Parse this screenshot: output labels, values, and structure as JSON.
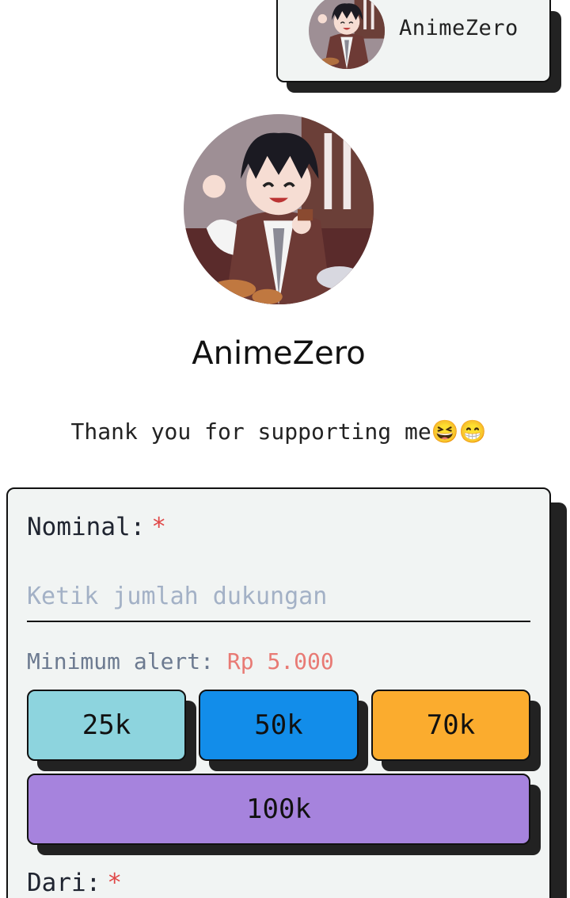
{
  "header": {
    "chip_name": "AnimeZero",
    "avatar_icon": "anime-avatar-image"
  },
  "profile": {
    "name": "AnimeZero",
    "tagline": "Thank you for supporting me😆😁"
  },
  "form": {
    "nominal_label": "Nominal:",
    "required_mark": "*",
    "amount_placeholder": "Ketik jumlah dukungan",
    "amount_value": "",
    "min_alert_label": "Minimum alert:",
    "min_alert_amount": "Rp 5.000",
    "presets": [
      {
        "label": "25k",
        "color": "#8dd4de"
      },
      {
        "label": "50k",
        "color": "#128dea"
      },
      {
        "label": "70k",
        "color": "#fbac2e"
      },
      {
        "label": "100k",
        "color": "#a683dd"
      }
    ],
    "from_label": "Dari:"
  },
  "colors": {
    "card_bg": "#f1f4f3",
    "required": "#e04848",
    "shadow": "#222222"
  }
}
